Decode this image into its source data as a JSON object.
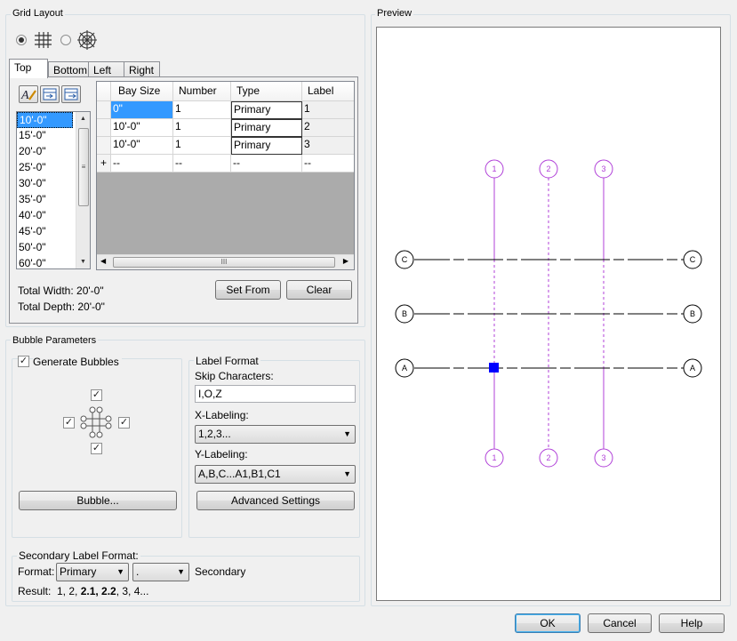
{
  "grid_layout": {
    "title": "Grid Layout",
    "tabs": [
      "Top",
      "Bottom",
      "Left",
      "Right"
    ],
    "bay_sizes": [
      "10'-0\"",
      "15'-0\"",
      "20'-0\"",
      "25'-0\"",
      "30'-0\"",
      "35'-0\"",
      "40'-0\"",
      "45'-0\"",
      "50'-0\"",
      "60'-0\""
    ],
    "table": {
      "headers": [
        "Bay Size",
        "Number",
        "Type",
        "Label"
      ],
      "rows": [
        [
          "0\"",
          "1",
          "Primary",
          "1"
        ],
        [
          "10'-0\"",
          "1",
          "Primary",
          "2"
        ],
        [
          "10'-0\"",
          "1",
          "Primary",
          "3"
        ],
        [
          "--",
          "--",
          "--",
          "--"
        ]
      ],
      "new_row_marker": "+",
      "scroll_grip": "III"
    },
    "total_width": "Total Width: 20'-0\"",
    "total_depth": "Total Depth: 20'-0\"",
    "set_from_label": "Set From",
    "clear_label": "Clear"
  },
  "bubble_parameters": {
    "title": "Bubble Parameters",
    "generate_bubbles_label": "Generate Bubbles",
    "bubble_button_label": "Bubble...",
    "label_format_title": "Label Format",
    "skip_characters_label": "Skip Characters:",
    "skip_characters_value": "I,O,Z",
    "x_labeling_label": "X-Labeling:",
    "x_labeling_value": "1,2,3...",
    "y_labeling_label": "Y-Labeling:",
    "y_labeling_value": "A,B,C...A1,B1,C1",
    "advanced_settings_label": "Advanced Settings"
  },
  "secondary_label_format": {
    "title": "Secondary Label Format:",
    "format_label": "Format:",
    "format_value": "Primary",
    "separator_value": ".",
    "secondary_text": "Secondary",
    "result_label": "Result:",
    "result_pre": "1, 2, ",
    "result_bold": "2.1, 2.2",
    "result_post": ", 3, 4..."
  },
  "preview": {
    "title": "Preview",
    "column_labels": [
      "1",
      "2",
      "3"
    ],
    "row_labels": [
      "C",
      "B",
      "A"
    ]
  },
  "footer": {
    "ok_label": "OK",
    "cancel_label": "Cancel",
    "help_label": "Help"
  },
  "colors": {
    "grid_column": "#b040d8",
    "grid_row": "#000000",
    "selection": "#0000ff",
    "highlight": "#3399ff"
  }
}
